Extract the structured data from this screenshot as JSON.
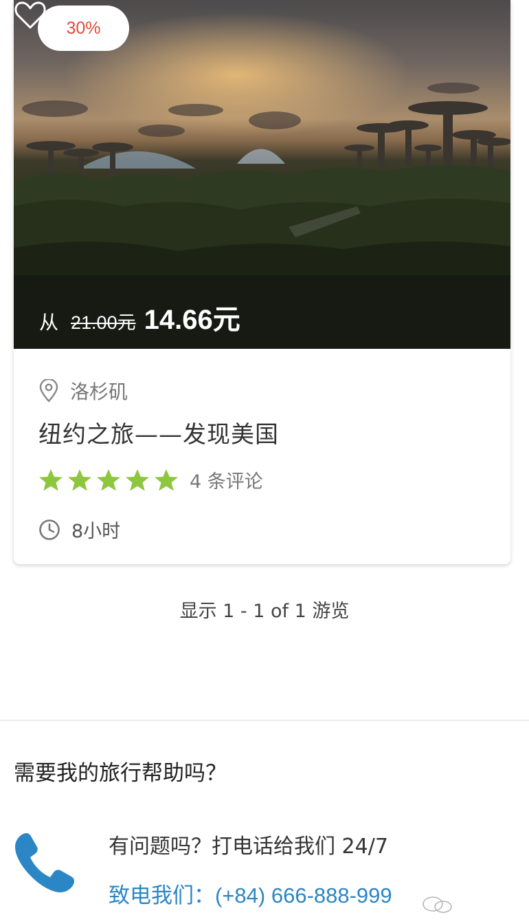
{
  "card": {
    "discount": "30%",
    "price_from": "从",
    "price_old": "21.00元",
    "price_new": "14.66元",
    "location": "洛杉矶",
    "title": "纽约之旅——发现美国",
    "rating": 5,
    "reviews": "4 条评论",
    "duration": "8小时"
  },
  "pagination": "显示 1 - 1 of 1 游览",
  "help": {
    "title": "需要我的旅行帮助吗？",
    "question": "有问题吗？打电话给我们 24/7",
    "phone_label": "致电我们：",
    "phone_number": "(+84) 666-888-999"
  },
  "colors": {
    "accent": "#2b86c5",
    "star": "#8dc63f",
    "badge_text": "#e04b3a"
  }
}
